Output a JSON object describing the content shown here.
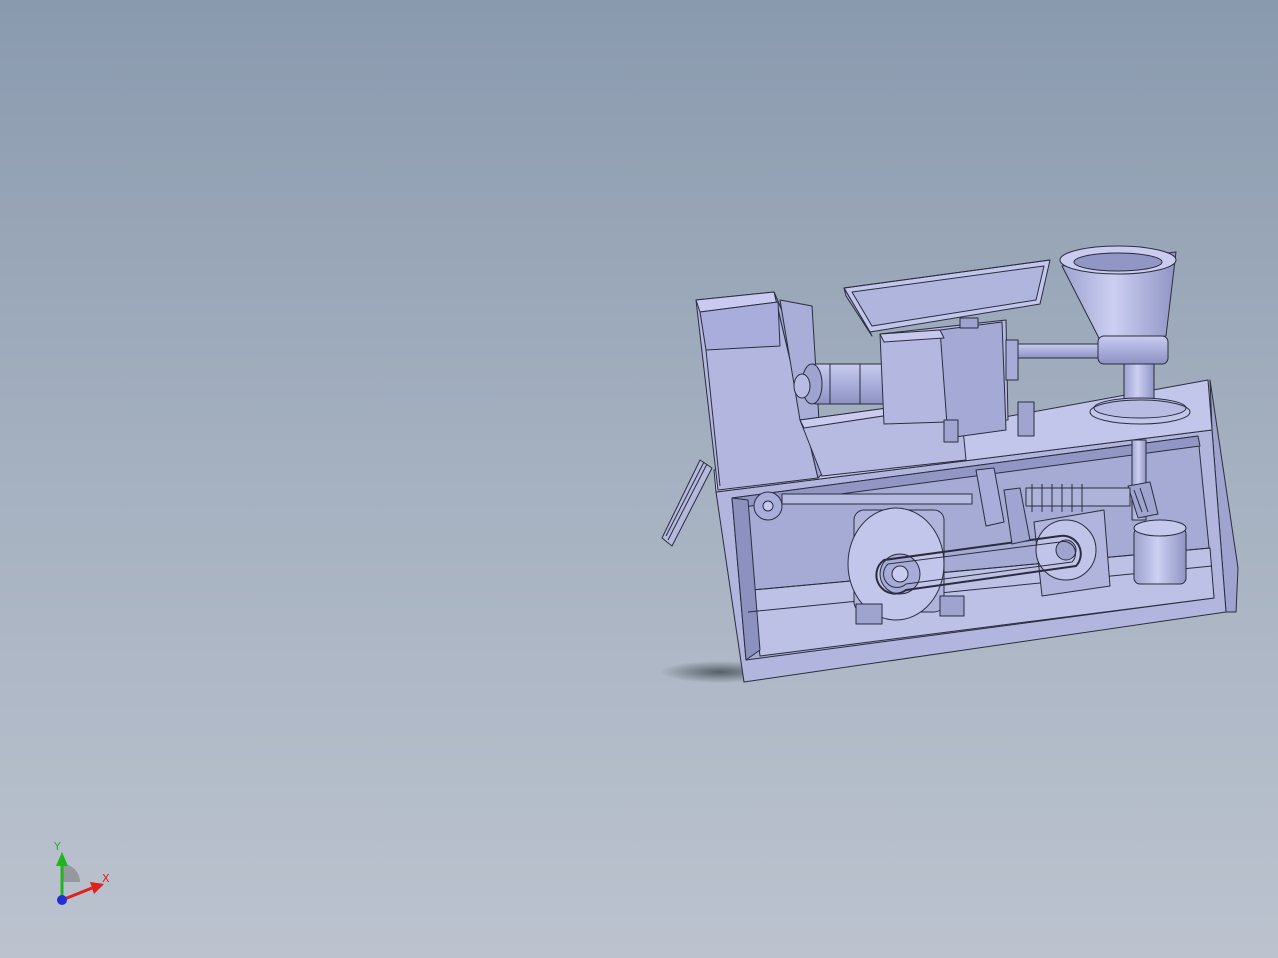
{
  "viewport": {
    "background_top": "#8a9aae",
    "background_bottom": "#bcc3cf",
    "part_fill": "#aeb3d8",
    "part_fill_light": "#c4c8ec",
    "part_fill_dark": "#8f94bf",
    "edge_color": "#2b2d3c"
  },
  "triad": {
    "x_label": "X",
    "y_label": "Y",
    "x_color": "#e0201c",
    "y_color": "#1fb51f",
    "z_color": "#2030d8"
  }
}
